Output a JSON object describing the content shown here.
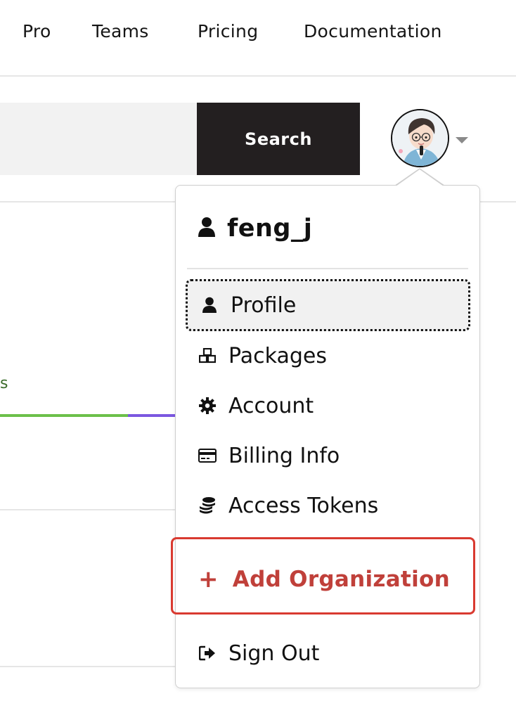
{
  "nav": {
    "links": [
      {
        "label": "Pro"
      },
      {
        "label": "Teams"
      },
      {
        "label": "Pricing"
      },
      {
        "label": "Documentation"
      }
    ]
  },
  "search": {
    "button_label": "Search",
    "value": "",
    "placeholder": ""
  },
  "avatar": {
    "icon": "user-avatar-image",
    "caret_icon": "caret-down-icon"
  },
  "background": {
    "fragment_text": "s",
    "bar_colors": [
      "#6cc04a",
      "#7b57e0"
    ]
  },
  "menu": {
    "username": "feng_j",
    "user_icon": "user-icon",
    "items": [
      {
        "label": "Profile",
        "icon": "user-icon",
        "active": true
      },
      {
        "label": "Packages",
        "icon": "cubes-icon"
      },
      {
        "label": "Account",
        "icon": "gear-icon"
      },
      {
        "label": "Billing Info",
        "icon": "credit-card-icon"
      },
      {
        "label": "Access Tokens",
        "icon": "coins-stack-icon"
      }
    ],
    "add_org": {
      "label": "Add Organization",
      "icon": "plus-icon",
      "color": "#c0403a"
    },
    "sign_out": {
      "label": "Sign Out",
      "icon": "sign-out-icon"
    },
    "highlight_color": "#d93a30"
  }
}
